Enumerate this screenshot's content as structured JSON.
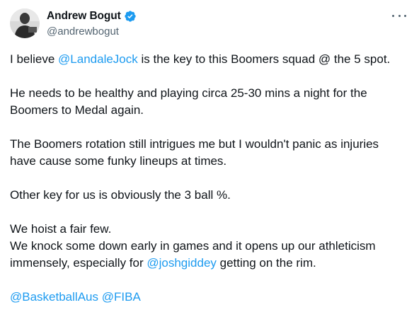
{
  "author": {
    "display_name": "Andrew Bogut",
    "handle": "@andrewbogut",
    "verified": true,
    "verified_color": "#1d9bf0"
  },
  "more_icon": "more-horizontal-icon",
  "tweet": {
    "p1": {
      "pre": "I believe ",
      "mention": "@LandaleJock",
      "post": " is the key to this Boomers squad @ the 5 spot."
    },
    "p2": {
      "l1": "He needs to be healthy and playing circa 25-30 mins a night for the",
      "l2": "Boomers to Medal again."
    },
    "p3": {
      "l1": "The Boomers rotation still intrigues me but I wouldn't panic as injuries",
      "l2": "have cause some funky lineups at times."
    },
    "p4": {
      "l1": "Other key for us is obviously the 3 ball %."
    },
    "p5": {
      "l1": "We hoist a fair few.",
      "l2": "We knock some down early in games and it opens up our athleticism",
      "l3_pre": "immensely, especially for ",
      "l3_mention": "@joshgiddey",
      "l3_post": " getting on the rim."
    },
    "p6": {
      "mention1": "@BasketballAus",
      "mention2": "@FIBA"
    }
  },
  "colors": {
    "text": "#0f1419",
    "secondary": "#536471",
    "link": "#1d9bf0"
  }
}
